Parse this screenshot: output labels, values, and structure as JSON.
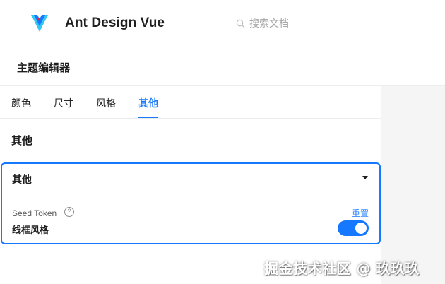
{
  "header": {
    "brand": "Ant Design Vue",
    "logo_icon": "ant-design-vue-logo",
    "search": {
      "placeholder": "搜索文档",
      "icon": "search-icon"
    }
  },
  "editor": {
    "title": "主题编辑器",
    "tabs": [
      {
        "label": "颜色",
        "active": false
      },
      {
        "label": "尺寸",
        "active": false
      },
      {
        "label": "风格",
        "active": false
      },
      {
        "label": "其他",
        "active": true
      }
    ],
    "section_title": "其他",
    "group": {
      "title": "其他",
      "expanded": true,
      "token_label": "Seed Token",
      "help_icon": "question-circle-icon",
      "reset_label": "重置",
      "token_name": "线框风格",
      "switch_on": true
    }
  },
  "watermark": "掘金技术社区 @ 玖玖玖",
  "colors": {
    "primary": "#1677ff",
    "text": "#1f1f1f",
    "muted": "#a6a6a6"
  }
}
